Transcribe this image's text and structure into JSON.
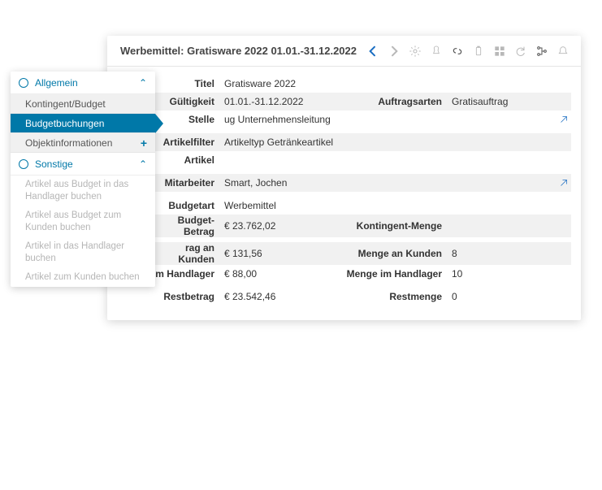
{
  "header": {
    "title": "Werbemittel: Gratisware 2022 01.01.-31.12.2022"
  },
  "sidebar": {
    "group1": {
      "label": "Allgemein"
    },
    "items1": {
      "kontingent": "Kontingent/Budget",
      "budgetbuchungen": "Budgetbuchungen",
      "objektinfo": "Objektinformationen"
    },
    "group2": {
      "label": "Sonstige"
    },
    "disabled": {
      "d1": "Artikel aus Budget in das Handlager buchen",
      "d2": "Artikel aus Budget zum Kunden buchen",
      "d3": "Artikel in das Handlager buchen",
      "d4": "Artikel zum Kunden buchen"
    }
  },
  "labels": {
    "titel": "Titel",
    "gueltigkeit": "Gültigkeit",
    "stelle": "Stelle",
    "artikelfilter": "Artikelfilter",
    "artikel": "Artikel",
    "mitarbeiter": "Mitarbeiter",
    "budgetart": "Budgetart",
    "budgetbetrag": "Budget-Betrag",
    "betragankunden": "rag an Kunden",
    "betragimhandlager": "im Handlager",
    "restbetrag": "Restbetrag",
    "auftragsarten": "Auftragsarten",
    "kontingentmenge": "Kontingent-Menge",
    "mengeankunden": "Menge an Kunden",
    "mengeimhandlager": "Menge im Handlager",
    "restmenge": "Restmenge"
  },
  "values": {
    "titel": "Gratisware 2022",
    "gueltigkeit": "01.01.-31.12.2022",
    "stelle": "ug Unternehmensleitung",
    "artikelfilter": "Artikeltyp Getränkeartikel",
    "artikel": "",
    "mitarbeiter": "Smart, Jochen",
    "budgetart": "Werbemittel",
    "budgetbetrag": "€ 23.762,02",
    "betragankunden": "€ 131,56",
    "betragimhandlager": "€ 88,00",
    "restbetrag": "€ 23.542,46",
    "auftragsarten": "Gratisauftrag",
    "kontingentmenge": "",
    "mengeankunden": "8",
    "mengeimhandlager": "10",
    "restmenge": "0"
  }
}
